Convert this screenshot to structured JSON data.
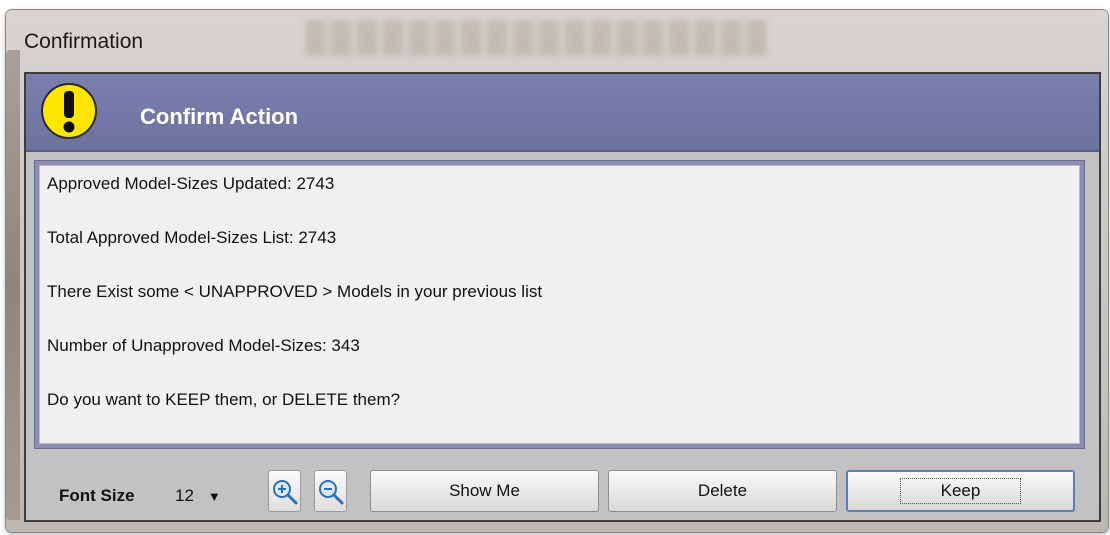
{
  "window": {
    "title": "Confirmation"
  },
  "header": {
    "title": "Confirm Action",
    "icon": "warning-icon",
    "icon_color": "#ffe600"
  },
  "message": {
    "lines": [
      "Approved Model-Sizes Updated:  2743",
      "Total Approved Model-Sizes List:  2743",
      "There Exist some < UNAPPROVED > Models in your previous list",
      "Number of Unapproved Model-Sizes:  343",
      "Do you want to KEEP them, or DELETE them?"
    ]
  },
  "toolbar": {
    "font_size_label": "Font Size",
    "font_size_value": "12",
    "zoom_in_icon": "zoom-in-icon",
    "zoom_out_icon": "zoom-out-icon",
    "show_me_label": "Show Me",
    "delete_label": "Delete",
    "keep_label": "Keep"
  },
  "colors": {
    "header_bg": "#7378a6",
    "panel_bg": "#c2c2c2",
    "message_bg": "#f0f0f0"
  }
}
